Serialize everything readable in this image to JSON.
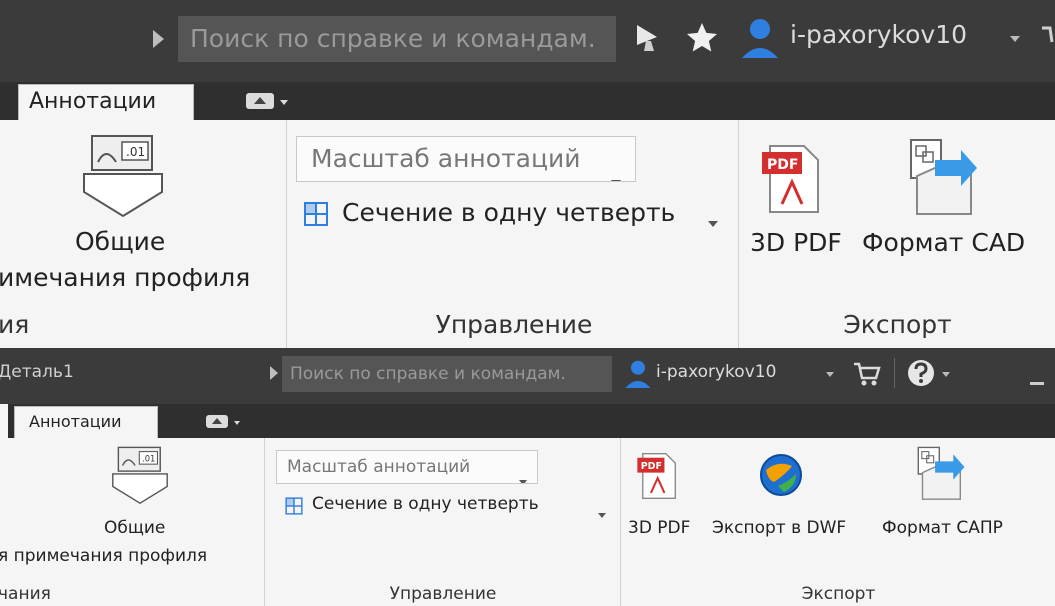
{
  "top": {
    "search_placeholder": "Поиск по справке и командам.",
    "username": "i-paxorykov10",
    "tab_label": "Аннотации",
    "general_notes_line1": "Общие",
    "general_notes_line2": "имечания профиля",
    "left_panel_title_fragment": "ия",
    "annotation_scale": "Масштаб аннотаций",
    "section_quarter": "Сечение в одну четверть",
    "manage_panel_title": "Управление",
    "export_3dpdf": "3D PDF",
    "export_cad_format": "Формат CAD",
    "export_panel_title": "Экспорт"
  },
  "bottom": {
    "doc_title": "Деталь1",
    "search_placeholder": "Поиск по справке и командам.",
    "username": "i-paxorykov10",
    "tab_label": "Аннотации",
    "general_notes_line1": "Общие",
    "general_notes_line2": "я  примечания профиля",
    "left_panel_title_fragment": "чания",
    "annotation_scale": "Масштаб аннотаций",
    "section_quarter": "Сечение в одну четверть",
    "manage_panel_title": "Управление",
    "export_3dpdf": "3D PDF",
    "export_dwf": "Экспорт в DWF",
    "export_cad_format": "Формат САПР",
    "export_panel_title": "Экспорт"
  },
  "colors": {
    "titlebar_bg": "#3b3b3b",
    "tabstrip_bg": "#2f2f2f",
    "ribbon_bg": "#f5f5f5",
    "user_icon_blue": "#2f7fe0",
    "pdf_red": "#d32f2f"
  },
  "icons": [
    "play-arrow-icon",
    "satellite-icon",
    "star-icon",
    "user-icon",
    "dropdown-arrow-icon",
    "cart-icon",
    "help-icon",
    "view-toggle-icon",
    "general-notes-icon",
    "section-quarter-icon",
    "pdf-icon",
    "dwf-globe-icon",
    "cad-export-icon"
  ]
}
